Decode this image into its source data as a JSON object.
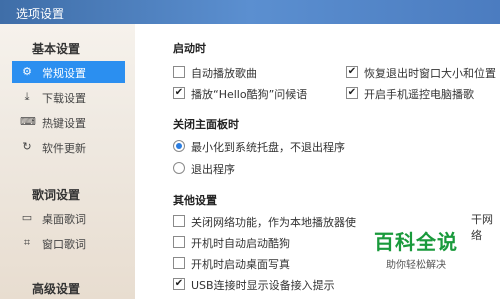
{
  "window": {
    "title": "选项设置"
  },
  "sidebar": {
    "groups": [
      {
        "heading": "基本设置",
        "items": [
          {
            "label": "常规设置",
            "icon": "settings-icon",
            "glyph": "⚙",
            "active": true
          },
          {
            "label": "下载设置",
            "icon": "download-icon",
            "glyph": "⤓"
          },
          {
            "label": "热键设置",
            "icon": "keyboard-icon",
            "glyph": "⌨"
          },
          {
            "label": "软件更新",
            "icon": "update-icon",
            "glyph": "↻"
          }
        ]
      },
      {
        "heading": "歌词设置",
        "items": [
          {
            "label": "桌面歌词",
            "icon": "desktop-lyrics-icon",
            "glyph": "▭"
          },
          {
            "label": "窗口歌词",
            "icon": "window-lyrics-icon",
            "glyph": "⌗"
          }
        ]
      },
      {
        "heading": "高级设置",
        "items": []
      }
    ]
  },
  "main": {
    "startup": {
      "title": "启动时",
      "options": [
        {
          "label": "自动播放歌曲",
          "checked": false
        },
        {
          "label": "恢复退出时窗口大小和位置",
          "checked": true
        },
        {
          "label": "播放“Hello酷狗”问候语",
          "checked": true
        },
        {
          "label": "开启手机遥控电脑播歌",
          "checked": true
        }
      ]
    },
    "close_panel": {
      "title": "关闭主面板时",
      "options": [
        {
          "label": "最小化到系统托盘，不退出程序",
          "selected": true
        },
        {
          "label": "退出程序",
          "selected": false
        }
      ]
    },
    "other": {
      "title": "其他设置",
      "options": [
        {
          "label": "关闭网络功能，作为本地播放器使",
          "checked": false
        },
        {
          "label": "开机时自动启动酷狗",
          "checked": false
        },
        {
          "label": "开机时启动桌面写真",
          "checked": false
        },
        {
          "label": "USB连接时显示设备接入提示",
          "checked": true
        }
      ],
      "cut_text": "干网络"
    }
  },
  "watermark": {
    "title": "百科全说",
    "subtitle": "助你轻松解决"
  },
  "colors": {
    "accent": "#2b8ff0",
    "title_bar": "#4b7cc0",
    "watermark": "#1a9a3c"
  }
}
